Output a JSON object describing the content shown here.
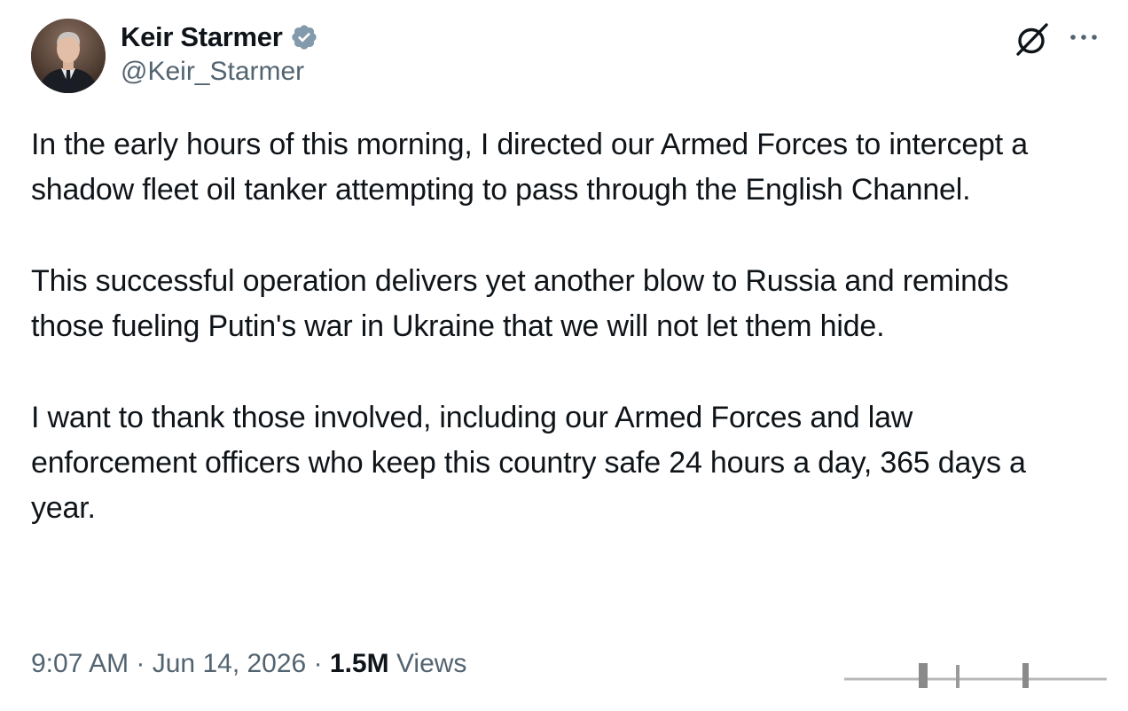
{
  "author": {
    "display_name": "Keir Starmer",
    "handle": "@Keir_Starmer",
    "verified": true
  },
  "tweet": {
    "paragraphs": [
      "In the early hours of this morning, I directed our Armed Forces to intercept a shadow fleet oil tanker attempting to pass through the English Channel.",
      "This successful operation delivers yet another blow to Russia and reminds those fueling Putin's war in Ukraine that we will not let them hide.",
      "I want to thank those involved, including our Armed Forces and law enforcement officers who keep this country safe 24 hours a day, 365 days a year."
    ],
    "time": "9:07 AM",
    "separator": " · ",
    "date": "Jun 14, 2026",
    "views_count": "1.5M",
    "views_label": " Views"
  },
  "icons": {
    "verified": "verified-badge-icon",
    "grok": "grok-icon",
    "more": "more-options-icon"
  },
  "colors": {
    "text": "#0f1419",
    "secondary": "#536471",
    "verified_badge": "#829aab"
  }
}
